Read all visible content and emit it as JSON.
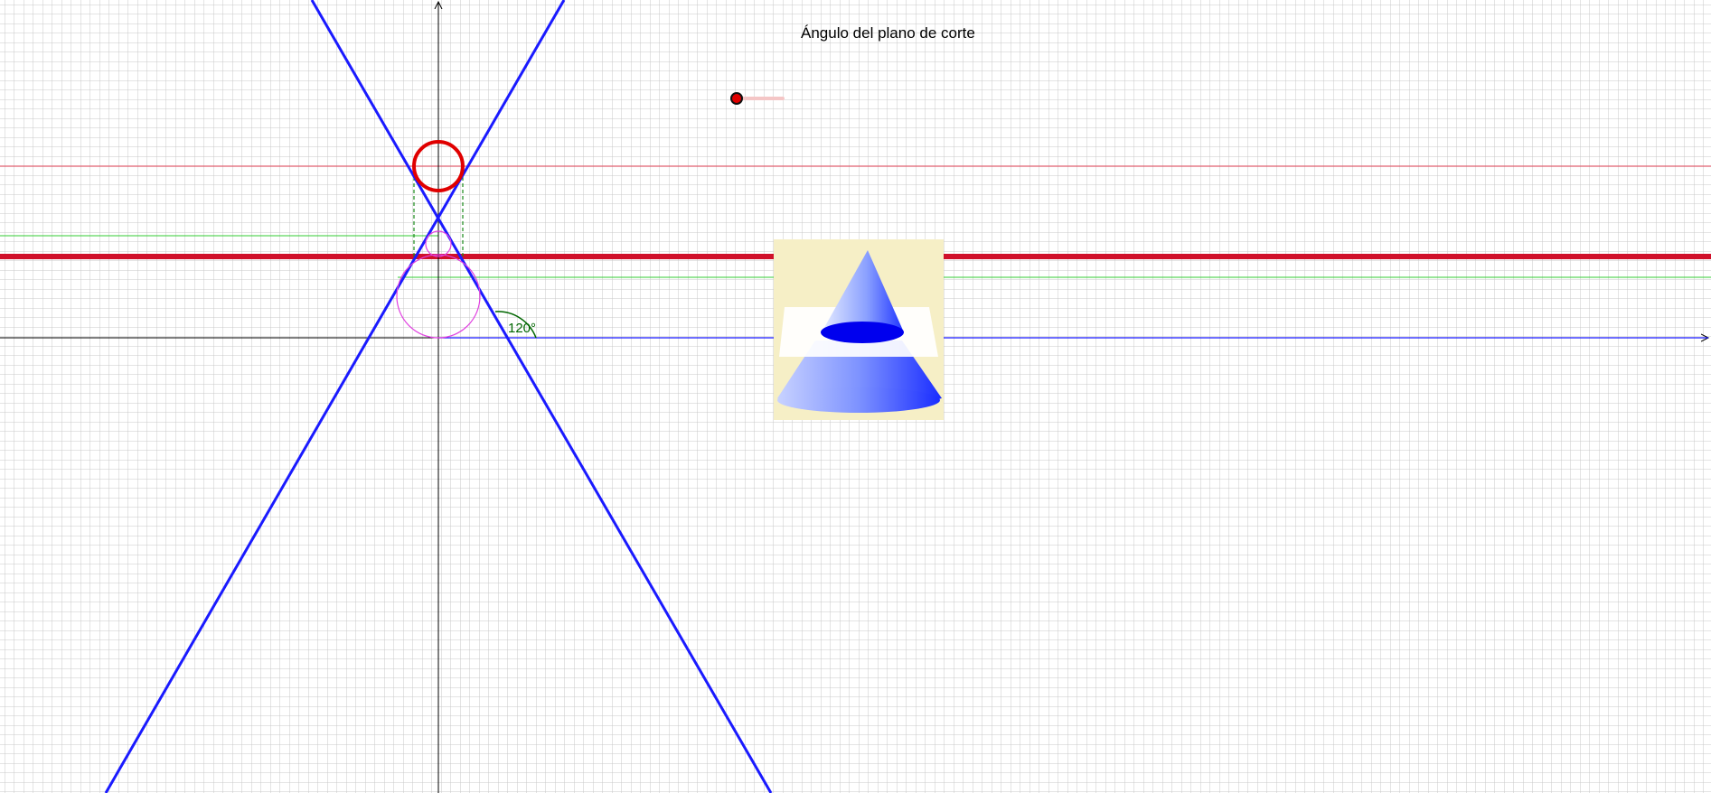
{
  "slider": {
    "title": "Ángulo del plano de corte",
    "value_fraction": 0.0,
    "accent_color": "#e00000"
  },
  "graph": {
    "angle_label": "120°",
    "colors": {
      "grid": "#c8c8c8",
      "axis": "#000000",
      "cone_lines": "#1a1aff",
      "cut_line": "#d0102a",
      "circle": "#e00000",
      "inscribed_circles": "#e040e0",
      "guide_lines": "#33cc33",
      "angle_arc": "#006600"
    }
  },
  "image": {
    "background_color": "#f6efc6",
    "cone_color": "#2f4bff",
    "plane_color": "#ffffff",
    "section_color": "#0000ee"
  }
}
